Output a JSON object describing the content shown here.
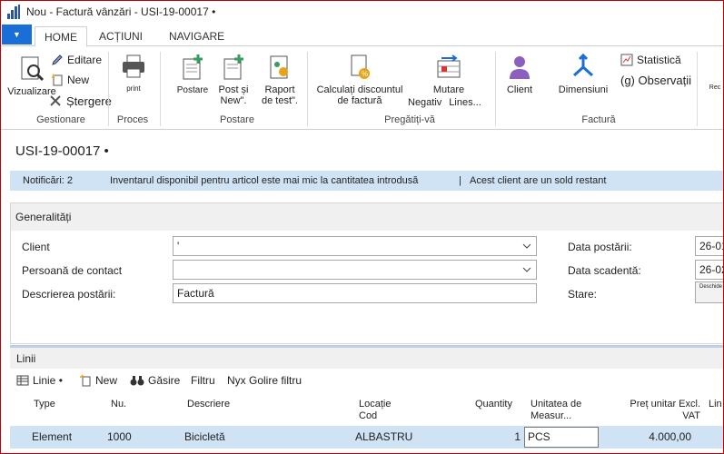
{
  "window": {
    "title": "Nou - Factură vânzări - USI-19-00017 •"
  },
  "tabs": [
    {
      "label": "HOME",
      "active": true
    },
    {
      "label": "ACȚIUNI",
      "active": false
    },
    {
      "label": "NAVIGARE",
      "active": false
    }
  ],
  "ribbon": {
    "gestionare": {
      "label": "Gestionare",
      "vizualizare": "Vizualizare",
      "editare": "Editare",
      "new": "New",
      "stergere": "Ștergere"
    },
    "proces": {
      "label": "Proces",
      "print": "print"
    },
    "postare": {
      "label": "Postare",
      "postare_btn": "Postare",
      "post_new": "Post și New\".",
      "raport": "Raport de test\"."
    },
    "pregatiti": {
      "label": "Pregătiți-vă",
      "calculati": "Calculați discountul de factură",
      "mutare": "Mutare",
      "negativ": "Negativ",
      "lines": "Lines..."
    },
    "factura": {
      "label": "Factură",
      "client": "Client",
      "dimensiuni": "Dimensiuni",
      "statistica": "Statistică",
      "observatii": "(g) Observații"
    },
    "overflow": "Rec"
  },
  "page": {
    "title": "USI-19-00017 •"
  },
  "notifications": {
    "count_label": "Notificări: 2",
    "msg1": "Inventarul disponibil pentru articol este mai mic la cantitatea introdusă",
    "sep": "|",
    "msg2": "Acest client are un sold restant"
  },
  "general": {
    "header": "Generalități",
    "client_label": "Client",
    "client_value": "'",
    "contact_label": "Persoană de contact",
    "contact_value": "",
    "desc_label": "Descrierea postării:",
    "desc_value": "Factură",
    "data_post_label": "Data postării:",
    "data_post_value": "26-01",
    "data_scad_label": "Data scadentă:",
    "data_scad_value": "26-02",
    "stare_label": "Stare:",
    "stare_value": "Deschide"
  },
  "lines": {
    "header": "Linii",
    "toolbar": {
      "linie": "Linie •",
      "new": "New",
      "gasire": "Găsire",
      "filtru": "Filtru",
      "golire": "Nyx Golire filtru"
    },
    "columns": {
      "type": "Type",
      "nu": "Nu.",
      "descriere": "Descriere",
      "locatie": "Locație",
      "cod": "Cod",
      "quantity": "Quantity",
      "unitatea": "Unitatea de",
      "measur": "Measur...",
      "pret": "Preț unitar Excl.",
      "vat": "VAT",
      "lin": "Lin"
    },
    "rows": [
      {
        "type": "Element",
        "nu": "1000",
        "descriere": "Bicicletă",
        "cod": "ALBASTRU",
        "quantity": "1",
        "unit": "PCS",
        "pret": "4.000,00"
      }
    ]
  },
  "colors": {
    "accent": "#1a6ed8",
    "notif_bg": "#cfe3f5",
    "border": "#c00000"
  }
}
